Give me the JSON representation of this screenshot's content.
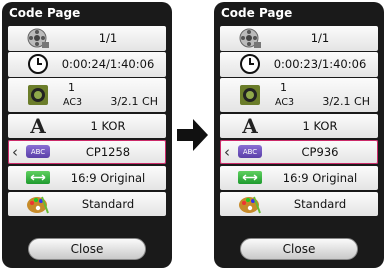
{
  "left": {
    "title": "Code Page",
    "title_icon": "reel-icon",
    "chapter": "1/1",
    "time": "0:00:24/1:40:06",
    "audio_num": "1",
    "audio_codec": "AC3",
    "audio_ch": "3/2.1 CH",
    "subtitle_lang": "1 KOR",
    "code_page": "CP1258",
    "aspect": "16:9 Original",
    "picture_mode": "Standard",
    "close_label": "Close"
  },
  "right": {
    "title": "Code Page",
    "chapter": "1/1",
    "time": "0:00:23/1:40:06",
    "audio_num": "1",
    "audio_codec": "AC3",
    "audio_ch": "3/2.1 CH",
    "subtitle_lang": "1 KOR",
    "code_page": "CP936",
    "aspect": "16:9 Original",
    "picture_mode": "Standard",
    "close_label": "Close"
  },
  "icons": {
    "abc": "ABC",
    "colors": {
      "selection": "#cc2b6a",
      "abc": "#6a4fc0",
      "ratio": "#2fae3f"
    }
  }
}
